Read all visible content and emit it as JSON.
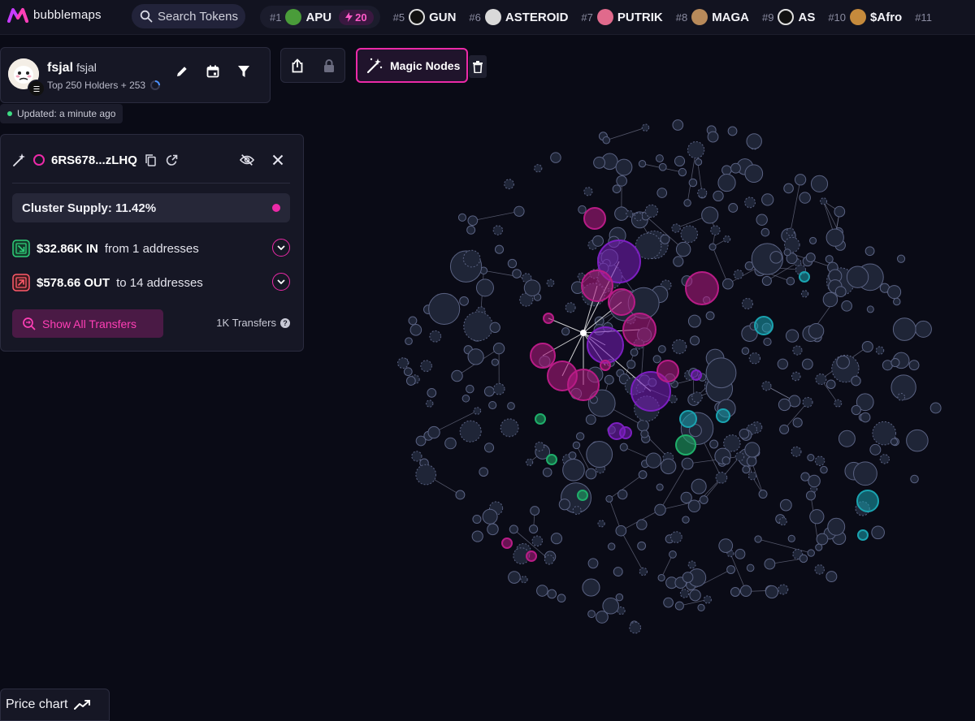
{
  "brand": {
    "name": "bubblemaps"
  },
  "search": {
    "label": "Search Tokens"
  },
  "tokens": [
    {
      "rank": "#1",
      "name": "APU",
      "boost": "20",
      "avatar_color": "#4a9c3a"
    },
    {
      "rank": "#5",
      "name": "GUN",
      "avatar_color": "#e8e8e8"
    },
    {
      "rank": "#6",
      "name": "ASTEROID",
      "avatar_color": "#d9d9d9"
    },
    {
      "rank": "#7",
      "name": "PUTRIK",
      "avatar_color": "#e06a8c"
    },
    {
      "rank": "#8",
      "name": "MAGA",
      "avatar_color": "#b88a5a"
    },
    {
      "rank": "#9",
      "name": "AS",
      "avatar_color": "#e0e0e0"
    },
    {
      "rank": "#10",
      "name": "$Afro",
      "avatar_color": "#c58a3c"
    },
    {
      "rank": "#11",
      "name": ""
    }
  ],
  "profile": {
    "name": "fsjal",
    "handle": "fsjal",
    "subtitle": "Top 250 Holders + 253",
    "updated": "Updated: a minute ago"
  },
  "magic": {
    "label": "Magic Nodes"
  },
  "cluster": {
    "address": "6RS678...zLHQ",
    "supply": "Cluster Supply: 11.42%",
    "in_amount": "$32.86K IN",
    "in_desc": "from 1 addresses",
    "out_amount": "$578.66 OUT",
    "out_desc": "to 14 addresses",
    "show_all": "Show All Transfers",
    "transfers": "1K Transfers"
  },
  "price_chart": {
    "label": "Price chart"
  },
  "colors": {
    "accent": "#ec2aa8",
    "node_default": "#2a3045",
    "cluster_magenta": "#b81c86",
    "cluster_purple": "#7c1fc0",
    "cluster_teal": "#1aa3b0",
    "cluster_green": "#1fae6a"
  }
}
